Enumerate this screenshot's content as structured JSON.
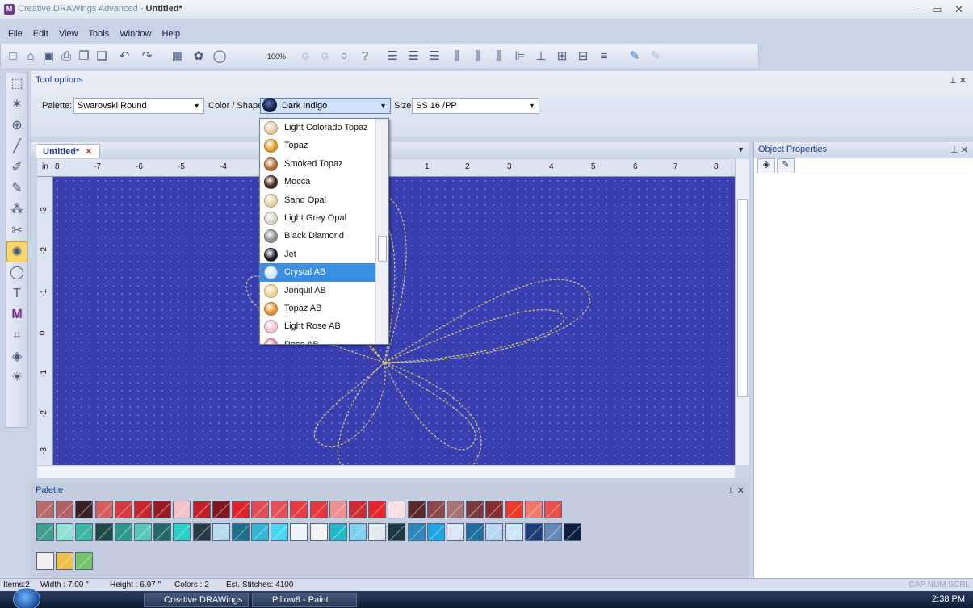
{
  "window": {
    "title_prefix": "Creative DRAWings Advanced - ",
    "title_doc": "Untitled*",
    "controls": "– ▭ ✕"
  },
  "menu": [
    "File",
    "Edit",
    "View",
    "Tools",
    "Window",
    "Help"
  ],
  "toolbar": {
    "zoom": "100%"
  },
  "tool_options": {
    "header": "Tool options",
    "palette_label": "Palette:",
    "palette_value": "Swarovski Round",
    "color_label": "Color / Shape:",
    "color_value": "Dark Indigo",
    "size_label": "Size:",
    "size_value": "SS 16 /PP"
  },
  "color_dropdown": {
    "items": [
      {
        "label": "Light Colorado Topaz",
        "color": "#e7c9a0"
      },
      {
        "label": "Topaz",
        "color": "#e09a2b"
      },
      {
        "label": "Smoked Topaz",
        "color": "#b06a2e"
      },
      {
        "label": "Mocca",
        "color": "#4a2b18"
      },
      {
        "label": "Sand Opal",
        "color": "#e3d2a3"
      },
      {
        "label": "Light Grey Opal",
        "color": "#d6d1c4"
      },
      {
        "label": "Black Diamond",
        "color": "#8f8f95"
      },
      {
        "label": "Jet",
        "color": "#1b1b24"
      },
      {
        "label": "Crystal AB",
        "color": "#cfe6ff"
      },
      {
        "label": "Jonquil AB",
        "color": "#f0d58c"
      },
      {
        "label": "Topaz AB",
        "color": "#e98f2c"
      },
      {
        "label": "Light Rose AB",
        "color": "#efc2cc"
      },
      {
        "label": "Rose AB",
        "color": "#e58aa0"
      }
    ],
    "selected_index": 8
  },
  "document_tab": {
    "label": "Untitled*",
    "close": "✕"
  },
  "ruler": {
    "unit": "in",
    "h_ticks": [
      "8",
      "-7",
      "-6",
      "-5",
      "-4",
      "1",
      "2",
      "3",
      "4",
      "5",
      "6",
      "7",
      "8"
    ],
    "v_ticks": [
      "-3",
      "-2",
      "-1",
      "0",
      "-1",
      "-2",
      "-3"
    ]
  },
  "object_properties": {
    "header": "Object Properties"
  },
  "palette_panel": {
    "header": "Palette",
    "row1": [
      "#b8696a",
      "#b36062",
      "#3d2024",
      "#d85b5b",
      "#d63a3e",
      "#c8262c",
      "#9a1d23",
      "#f2c2c7",
      "#c21e27",
      "#7f171d",
      "#e02127",
      "#e24c55",
      "#e35055",
      "#e63d43",
      "#e8343c",
      "#ef8f8e",
      "#cc2c2f",
      "#e6252b",
      "#f7e1e6",
      "#5a2a2b",
      "#8b4647",
      "#a67472",
      "#7b3b3a",
      "#8a2d2f",
      "#ef3a2a",
      "#f07a66",
      "#e8504a"
    ],
    "row2": [
      "#3fa08f",
      "#8ee0d3",
      "#3ab7a2",
      "#1f4a48",
      "#2a9a8f",
      "#58c8bd",
      "#1f6a66",
      "#28d0c6",
      "#2a3b44",
      "#b6dcee",
      "#1d6f8b",
      "#36b5d3",
      "#49d6f2",
      "#eaf6fb",
      "#f3f3f3",
      "#1fb9c9",
      "#7fd1f2",
      "#dfe9ee",
      "#1c3840",
      "#2a87b8",
      "#1da7e4",
      "#d7e6f5",
      "#1f6f9e",
      "#b7d7f0",
      "#cde7f8",
      "#1c3c7a",
      "#6489b8",
      "#0e1f3f"
    ],
    "row3": [
      "#f3eded",
      "#f0c14a",
      "#74c56a"
    ]
  },
  "status": {
    "items": "Items:2",
    "width": "Width : 7.00 \"",
    "height": "Height : 6.97 \"",
    "colors": "Colors : 2",
    "stitches": "Est. Stitches: 4100",
    "indicators": "CAP NUM SCRL"
  },
  "taskbar": {
    "app1": "Creative DRAWings ...",
    "app2": "Pillow8 - Paint",
    "time": "2:38 PM"
  }
}
